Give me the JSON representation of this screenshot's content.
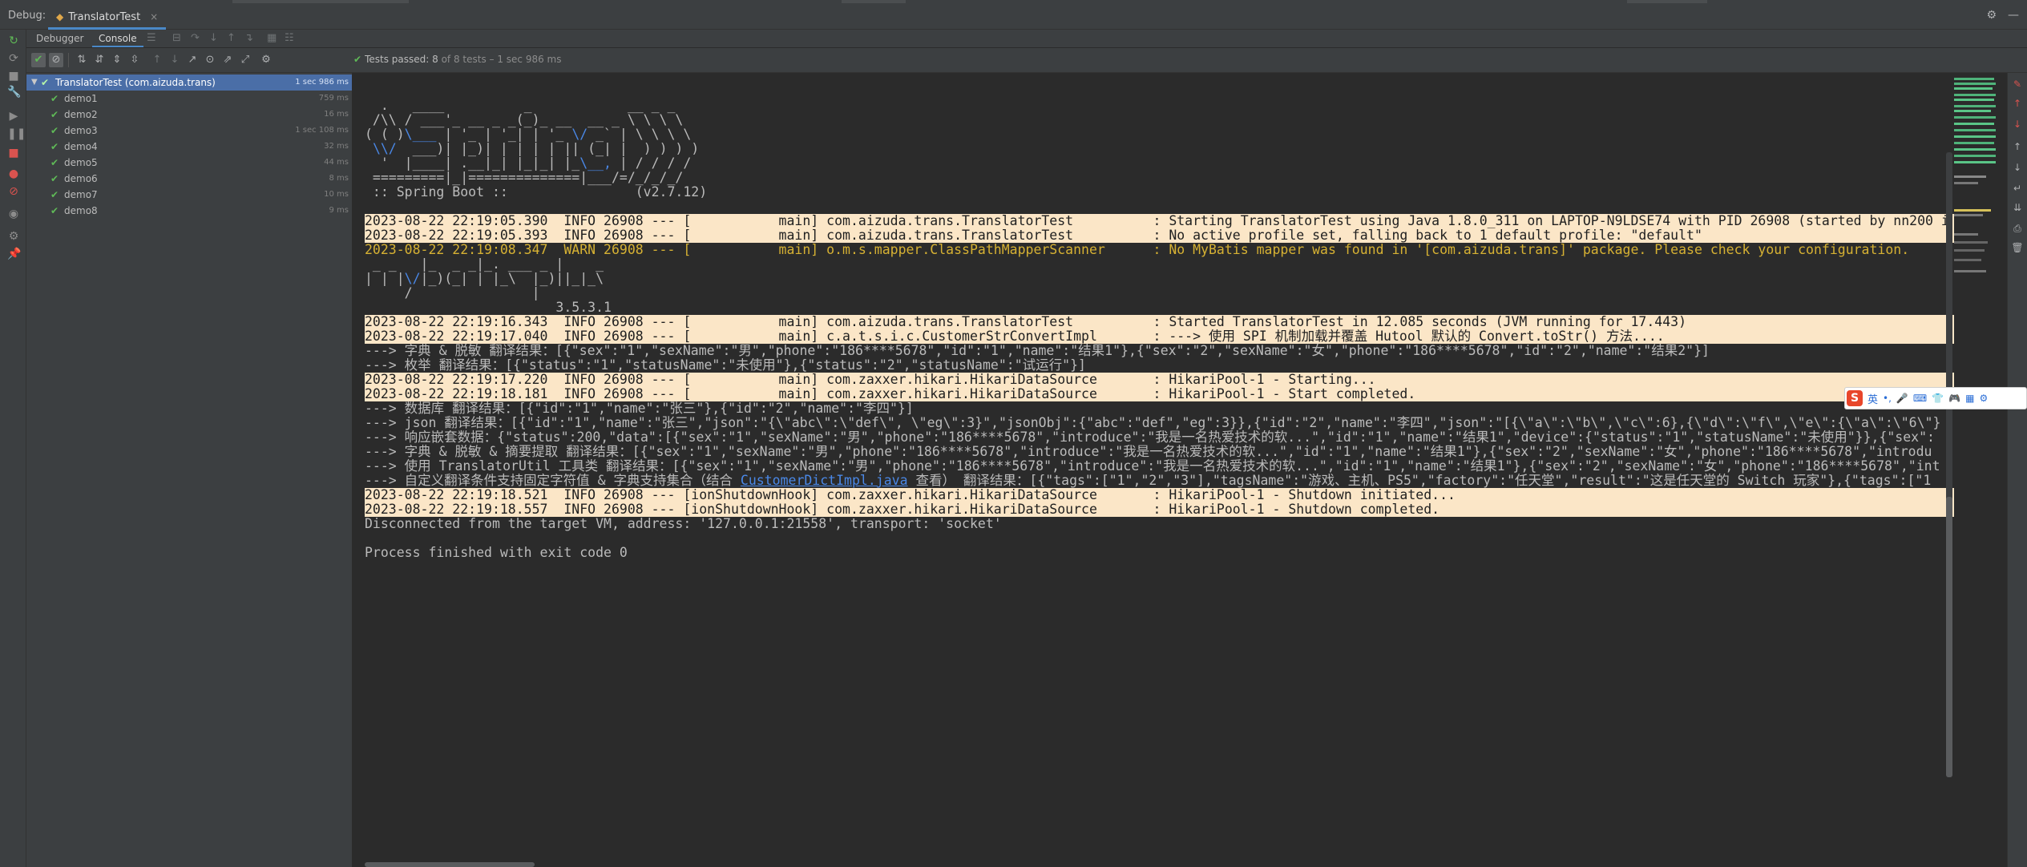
{
  "header": {
    "debug_label": "Debug:",
    "session_tab": "TranslatorTest",
    "session_close": "×",
    "right_icons": [
      "gear-icon",
      "minimize-icon"
    ]
  },
  "subtabs": {
    "debugger": "Debugger",
    "console": "Console"
  },
  "status": {
    "text": "Tests passed:",
    "passed": "8",
    "detail": "of 8 tests – 1 sec 986 ms"
  },
  "tree": {
    "root": {
      "name": "TranslatorTest (com.aizuda.trans)",
      "duration": "1 sec 986 ms"
    },
    "items": [
      {
        "name": "demo1",
        "duration": "759 ms"
      },
      {
        "name": "demo2",
        "duration": "16 ms"
      },
      {
        "name": "demo3",
        "duration": "1 sec 108 ms"
      },
      {
        "name": "demo4",
        "duration": "32 ms"
      },
      {
        "name": "demo5",
        "duration": "44 ms"
      },
      {
        "name": "demo6",
        "duration": "8 ms"
      },
      {
        "name": "demo7",
        "duration": "10 ms"
      },
      {
        "name": "demo8",
        "duration": "9 ms"
      }
    ]
  },
  "console": {
    "banner": [
      "  .   ____          _            __ _ _",
      " /\\\\ / ___'_ __ _ _(_)_ __  __ _ \\ \\ \\ \\",
      "( ( )\\___ | '_ | '_| | '_ \\/ _` | \\ \\ \\ \\",
      " \\\\/  ___)| |_)| | | | | || (_| |  ) ) ) )",
      "  '  |____| .__|_| |_|_| |_\\__, | / / / /",
      " =========|_|==============|___/=/_/_/_/",
      " :: Spring Boot ::                (v2.7.12)"
    ],
    "log1": "2023-08-22 22:19:05.390  INFO 26908 --- [           main] com.aizuda.trans.TranslatorTest          : Starting TranslatorTest using Java 1.8.0_311 on LAPTOP-N9LDSE74 with PID 26908 (started by nn200 i",
    "log2": "2023-08-22 22:19:05.393  INFO 26908 --- [           main] com.aizuda.trans.TranslatorTest          : No active profile set, falling back to 1 default profile: \"default\"",
    "log3": "2023-08-22 22:19:08.347  WARN 26908 --- [           main] o.m.s.mapper.ClassPathMapperScanner      : No MyBatis mapper was found in '[com.aizuda.trans]' package. Please check your configuration.",
    "mp_banner": [
      " _ _   |_  _ _|_. ___ _ |    _",
      "| | |\\/|_)(_| | |_\\  |_)||_|_\\",
      "     /               |",
      "                        3.5.3.1"
    ],
    "log4": "2023-08-22 22:19:16.343  INFO 26908 --- [           main] com.aizuda.trans.TranslatorTest          : Started TranslatorTest in 12.085 seconds (JVM running for 17.443)",
    "log5": "2023-08-22 22:19:17.040  INFO 26908 --- [           main] c.a.t.s.i.c.CustomerStrConvertImpl       : ---> 使用 SPI 机制加载并覆盖 Hutool 默认的 Convert.toStr() 方法....",
    "out1": "---> 字典 & 脱敏 翻译结果：[{\"sex\":\"1\",\"sexName\":\"男\",\"phone\":\"186****5678\",\"id\":\"1\",\"name\":\"结果1\"},{\"sex\":\"2\",\"sexName\":\"女\",\"phone\":\"186****5678\",\"id\":\"2\",\"name\":\"结果2\"}]",
    "out2": "---> 枚举 翻译结果：[{\"status\":\"1\",\"statusName\":\"未使用\"},{\"status\":\"2\",\"statusName\":\"试运行\"}]",
    "log6": "2023-08-22 22:19:17.220  INFO 26908 --- [           main] com.zaxxer.hikari.HikariDataSource       : HikariPool-1 - Starting...",
    "log7": "2023-08-22 22:19:18.181  INFO 26908 --- [           main] com.zaxxer.hikari.HikariDataSource       : HikariPool-1 - Start completed.",
    "out3": "---> 数据库 翻译结果：[{\"id\":\"1\",\"name\":\"张三\"},{\"id\":\"2\",\"name\":\"李四\"}]",
    "out4": "---> json 翻译结果：[{\"id\":\"1\",\"name\":\"张三\",\"json\":\"{\\\"abc\\\":\\\"def\\\", \\\"eg\\\":3}\",\"jsonObj\":{\"abc\":\"def\",\"eg\":3}},{\"id\":\"2\",\"name\":\"李四\",\"json\":\"[{\\\"a\\\":\\\"b\\\",\\\"c\\\":6},{\\\"d\\\":\\\"f\\\",\\\"e\\\":{\\\"a\\\":\\\"6\\\"}",
    "out5": "---> 响应嵌套数据：{\"status\":200,\"data\":[{\"sex\":\"1\",\"sexName\":\"男\",\"phone\":\"186****5678\",\"introduce\":\"我是一名热爱技术的软...\",\"id\":\"1\",\"name\":\"结果1\",\"device\":{\"status\":\"1\",\"statusName\":\"未使用\"}},{\"sex\":",
    "out6": "---> 字典 & 脱敏 & 摘要提取 翻译结果：[{\"sex\":\"1\",\"sexName\":\"男\",\"phone\":\"186****5678\",\"introduce\":\"我是一名热爱技术的软...\",\"id\":\"1\",\"name\":\"结果1\"},{\"sex\":\"2\",\"sexName\":\"女\",\"phone\":\"186****5678\",\"introdu",
    "out7": "---> 使用 TranslatorUtil 工具类 翻译结果：[{\"sex\":\"1\",\"sexName\":\"男\",\"phone\":\"186****5678\",\"introduce\":\"我是一名热爱技术的软...\",\"id\":\"1\",\"name\":\"结果1\"},{\"sex\":\"2\",\"sexName\":\"女\",\"phone\":\"186****5678\",\"int",
    "out8_pre": "---> 自定义翻译条件支持固定字符值 & 字典支持集合（结合 ",
    "out8_link": "CustomerDictImpl.java",
    "out8_post": " 查看） 翻译结果：[{\"tags\":[\"1\",\"2\",\"3\"],\"tagsName\":\"游戏、主机、PS5\",\"factory\":\"任天堂\",\"result\":\"这是任天堂的 Switch 玩家\"},{\"tags\":[\"1",
    "log8": "2023-08-22 22:19:18.521  INFO 26908 --- [ionShutdownHook] com.zaxxer.hikari.HikariDataSource       : HikariPool-1 - Shutdown initiated...",
    "log9": "2023-08-22 22:19:18.557  INFO 26908 --- [ionShutdownHook] com.zaxxer.hikari.HikariDataSource       : HikariPool-1 - Shutdown completed.",
    "disconnect": "Disconnected from the target VM, address: '127.0.0.1:21558', transport: 'socket'",
    "exit": "Process finished with exit code 0"
  },
  "ime": {
    "logo": "S",
    "lang": "英"
  },
  "colors": {
    "info_band": "#fbe6c7",
    "warn_text": "#d6b133",
    "pass_green": "#5fb957",
    "selection": "#4a6ea7",
    "link_blue": "#4a88e7"
  }
}
